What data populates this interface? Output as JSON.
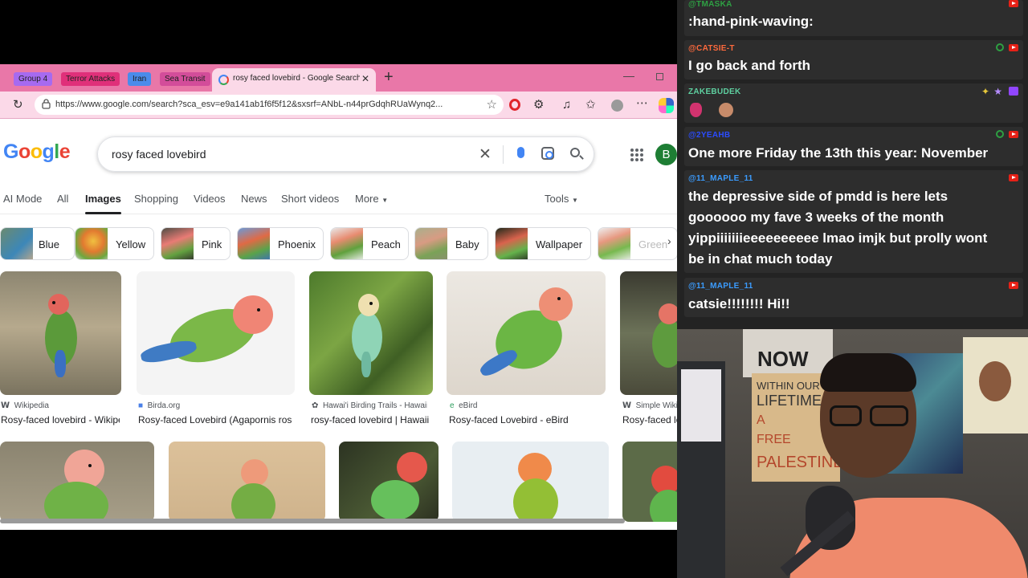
{
  "browser": {
    "tab_groups": [
      "Group 4",
      "Terror Attacks",
      "Iran",
      "Sea Transit"
    ],
    "active_tab_title": "rosy faced lovebird - Google Search",
    "url": "https://www.google.com/search?sca_esv=e9a141ab1f6f5f12&sxsrf=ANbL-n44prGdqhRUaWynq2...",
    "search_query": "rosy faced lovebird",
    "user_initial": "B",
    "nav": [
      "AI Mode",
      "All",
      "Images",
      "Shopping",
      "Videos",
      "News",
      "Short videos",
      "More",
      "Tools"
    ],
    "chips": [
      "Blue",
      "Yellow",
      "Pink",
      "Phoenix",
      "Peach",
      "Baby",
      "Wallpaper",
      "Green"
    ],
    "results": [
      {
        "source": "Wikipedia",
        "caption": "Rosy-faced lovebird - Wikipedia"
      },
      {
        "source": "Birda.org",
        "caption": "Rosy-faced Lovebird (Agapornis roseicollis)"
      },
      {
        "source": "Hawai'i Birding Trails - Hawaii",
        "caption": "rosy-faced lovebird | Hawaii Birding Trails"
      },
      {
        "source": "eBird",
        "caption": "Rosy-faced Lovebird - eBird"
      },
      {
        "source": "Simple Wikipedia",
        "caption": "Rosy-faced lovebird"
      }
    ],
    "logo_colors": {
      "blue": "#4285f4",
      "red": "#ea4335",
      "yellow": "#fbbc05",
      "green": "#34a853"
    }
  },
  "chat": [
    {
      "user": "@TMASKA",
      "color": "#2ea043",
      "text": ":hand-pink-waving:"
    },
    {
      "user": "@CATSIE-T",
      "color": "#ff6a3d",
      "text": "I go back and forth"
    },
    {
      "user": "ZAKEBUDEK",
      "color": "#5ed0a0",
      "text": ""
    },
    {
      "user": "@2YEAHB",
      "color": "#2b4cff",
      "text": "One more Friday the 13th this year: November"
    },
    {
      "user": "@11_MAPLE_11",
      "color": "#3b9cff",
      "text_lines": [
        "the depressive side of pmdd is here lets",
        "goooooo my fave 3 weeks of the month",
        "yippiiiiiiieeeeeeeeee lmao imjk but prolly wont",
        "be in chat much today"
      ]
    },
    {
      "user": "@11_MAPLE_11",
      "color": "#3b9cff",
      "text": "catsie!!!!!!!! Hi!!"
    }
  ],
  "webcam": {
    "sign_lines": [
      "WITHIN OUR",
      "LIFETIME",
      "A",
      "FREE",
      "PALESTINE"
    ],
    "poster_text": "NOW"
  }
}
